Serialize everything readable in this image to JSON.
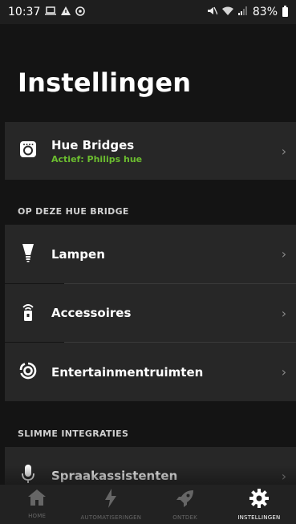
{
  "status_bar": {
    "time": "10:37",
    "left_icons": [
      "laptop-icon",
      "warning-icon",
      "sync-icon"
    ],
    "battery_percent": "83%"
  },
  "header": {
    "title": "Instellingen"
  },
  "bridge_row": {
    "title": "Hue Bridges",
    "subtitle": "Actief: Philips hue",
    "icon": "bridge-icon"
  },
  "section_bridge": {
    "header": "OP DEZE HUE BRIDGE",
    "items": [
      {
        "label": "Lampen",
        "icon": "lamp-icon"
      },
      {
        "label": "Accessoires",
        "icon": "remote-icon"
      },
      {
        "label": "Entertainmentruimten",
        "icon": "entertainment-icon"
      }
    ]
  },
  "section_integrations": {
    "header": "SLIMME INTEGRATIES",
    "items": [
      {
        "label": "Spraakassistenten",
        "icon": "microphone-icon"
      }
    ]
  },
  "bottom_nav": {
    "items": [
      {
        "label": "HOME",
        "icon": "home-icon",
        "active": false
      },
      {
        "label": "AUTOMATISERINGEN",
        "icon": "lightning-icon",
        "active": false
      },
      {
        "label": "ONTDEK",
        "icon": "rocket-icon",
        "active": false
      },
      {
        "label": "INSTELLINGEN",
        "icon": "gear-icon",
        "active": true
      }
    ]
  },
  "colors": {
    "background": "#141414",
    "row": "#272727",
    "accent_green": "#6bbd2f",
    "nav_active": "#ffffff",
    "nav_inactive": "#666666"
  }
}
